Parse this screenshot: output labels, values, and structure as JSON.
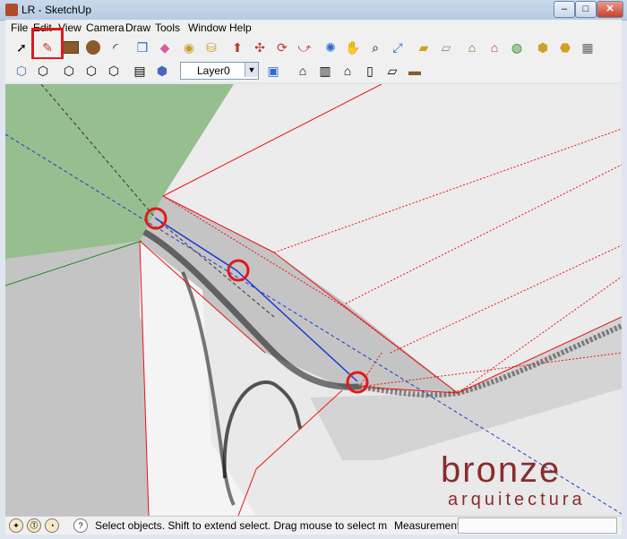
{
  "window": {
    "title": "LR - SketchUp"
  },
  "window_controls": {
    "minimize": "–",
    "maximize": "□",
    "close": "✕"
  },
  "menu": [
    "File",
    "Edit",
    "View",
    "Camera",
    "Draw",
    "Tools",
    "Window",
    "Help"
  ],
  "toolbar": {
    "layer_value": "Layer0",
    "highlighted_tool": "pencil-line-tool"
  },
  "statusbar": {
    "hint": "Select objects. Shift to extend select. Drag mouse to select m",
    "measurements_label": "Measurements",
    "measurements_value": ""
  },
  "watermark": {
    "main": "bronze",
    "sub": "arquitectura"
  },
  "colors": {
    "sky": "#c4c4c4",
    "ground": "#97be8e",
    "highlight": "#e0191c",
    "edge_red": "#e11",
    "axis_blue": "#1a3bd6",
    "axis_green": "#1d8a1d",
    "watermark": "#8a2c2c"
  }
}
